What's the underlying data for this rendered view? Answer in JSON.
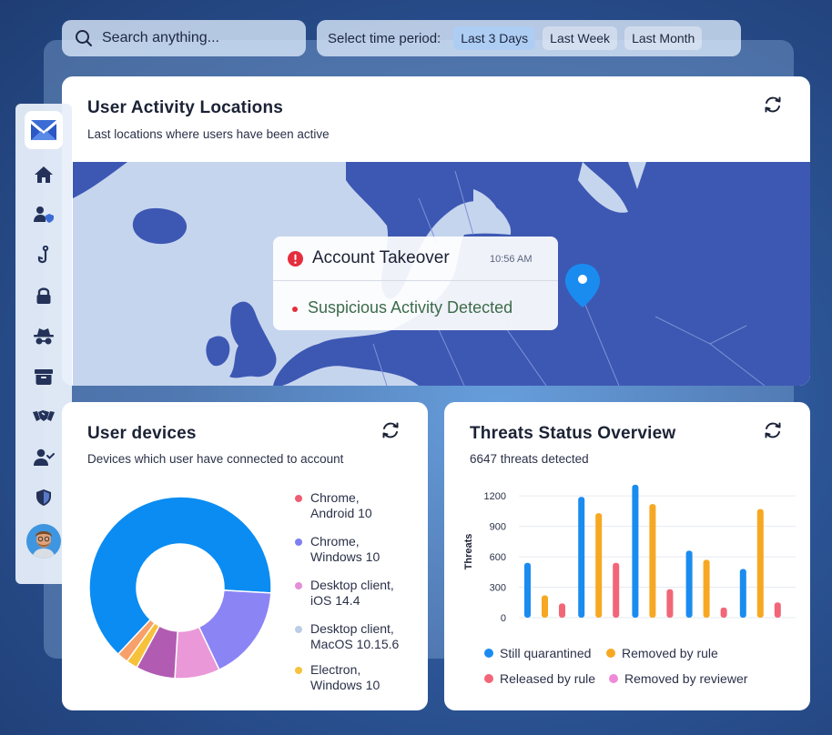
{
  "search": {
    "placeholder": "Search anything..."
  },
  "period": {
    "label": "Select time period:",
    "options": [
      "Last 3 Days",
      "Last Week",
      "Last Month"
    ],
    "selected": "Last 3 Days"
  },
  "sidebar": {
    "items": [
      {
        "icon": "home-icon"
      },
      {
        "icon": "user-shield-icon"
      },
      {
        "icon": "phishing-hook-icon"
      },
      {
        "icon": "lock-icon"
      },
      {
        "icon": "incognito-icon"
      },
      {
        "icon": "archive-icon"
      },
      {
        "icon": "handshake-icon"
      },
      {
        "icon": "user-check-icon"
      },
      {
        "icon": "shield-icon"
      }
    ]
  },
  "map": {
    "title": "User Activity Locations",
    "subtitle": "Last locations where users have been active",
    "popup": {
      "title": "Account Takeover",
      "time": "10:56 AM",
      "message": "Suspicious Activity Detected"
    }
  },
  "devices": {
    "title": "User devices",
    "subtitle": "Devices which user have connected to account",
    "legend": [
      {
        "line1": "Chrome,",
        "line2": "Android 10",
        "color": "#ef5d72"
      },
      {
        "line1": "Chrome,",
        "line2": "Windows 10",
        "color": "#7e80f2"
      },
      {
        "line1": "Desktop client,",
        "line2": "iOS 14.4",
        "color": "#e58fd6"
      },
      {
        "line1": "Desktop client,",
        "line2": "MacOS 10.15.6",
        "color": "#bccde6"
      },
      {
        "line1": "Electron,",
        "line2": "Windows 10",
        "color": "#f7c23b"
      }
    ]
  },
  "threats": {
    "title": "Threats Status Overview",
    "subtitle": "6647 threats detected",
    "legend": [
      {
        "label": "Still quarantined",
        "color": "#1a8cf0"
      },
      {
        "label": "Removed by rule",
        "color": "#f7a822"
      },
      {
        "label": "Released by rule",
        "color": "#f26678"
      },
      {
        "label": "Removed by reviewer",
        "color": "#ee8ad8"
      }
    ]
  },
  "chart_data": [
    {
      "type": "pie",
      "title": "User devices",
      "donut": true,
      "slices": [
        {
          "value": 64,
          "color": "#0a8cf2"
        },
        {
          "value": 17,
          "color": "#8b84f5"
        },
        {
          "value": 8,
          "color": "#ea98d8"
        },
        {
          "value": 7,
          "color": "#b25bb3"
        },
        {
          "value": 2,
          "color": "#f7c23b"
        },
        {
          "value": 2,
          "color": "#f7a06a"
        }
      ]
    },
    {
      "type": "bar",
      "title": "Threats Status Overview",
      "ylabel": "Threats",
      "ylim": [
        0,
        1300
      ],
      "yticks": [
        0,
        300,
        600,
        900,
        1200
      ],
      "groups": 5,
      "series": [
        {
          "name": "Still quarantined",
          "color": "#1a8cf0",
          "values": [
            540,
            1190,
            1310,
            660,
            480
          ]
        },
        {
          "name": "Removed by rule",
          "color": "#f7a822",
          "values": [
            220,
            1030,
            1120,
            570,
            1070
          ]
        },
        {
          "name": "Released by rule",
          "color": "#f26678",
          "values": [
            140,
            540,
            280,
            100,
            150
          ]
        }
      ]
    }
  ]
}
